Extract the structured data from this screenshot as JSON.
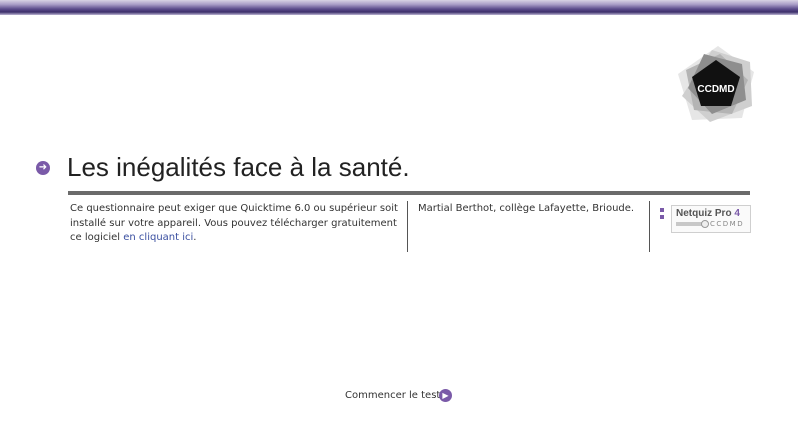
{
  "header": {
    "accent_color": "#5c4c8c"
  },
  "logo": {
    "text": "CCDMD"
  },
  "quiz": {
    "bullet_icon": "arrow-right-circle-icon",
    "title": "Les inégalités face à la santé."
  },
  "requirements": {
    "text": "Ce questionnaire peut exiger que Quicktime 6.0 ou supérieur soit installé sur votre appareil. Vous pouvez télécharger gratuitement ce logiciel ",
    "link_label": "en cliquant ici",
    "suffix": "."
  },
  "author": "Martial Berthot, collège Lafayette, Brioude.",
  "badge": {
    "product": "Netquiz Pro",
    "version": "4",
    "publisher": "CCDMD"
  },
  "start": {
    "label": "Commencer le test",
    "icon": "play-circle-icon"
  },
  "colors": {
    "accent": "#7a5aa8",
    "link": "#3a4fa0"
  }
}
